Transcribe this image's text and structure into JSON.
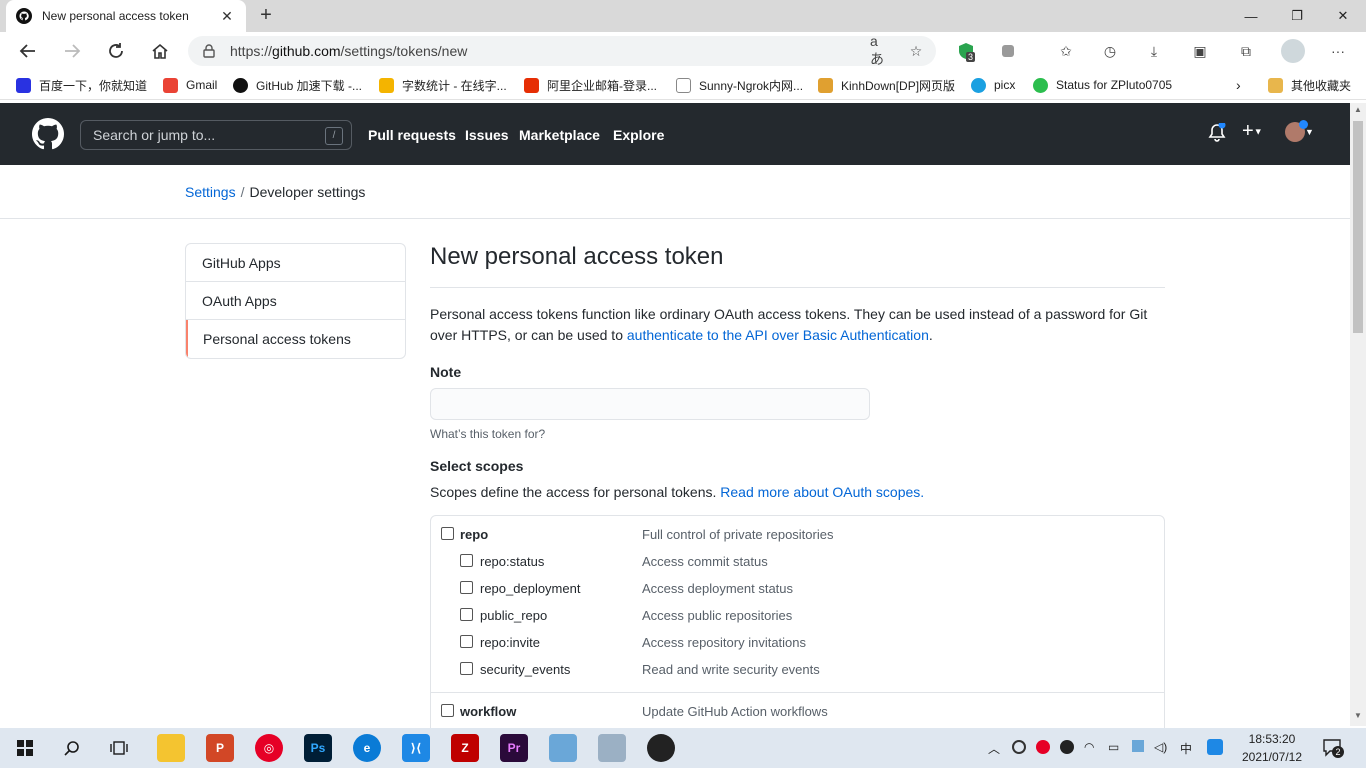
{
  "browser": {
    "tab_title": "New personal access token",
    "tab_close": "✕",
    "new_tab": "+",
    "url_prefix": "https://",
    "url_host": "github.com",
    "url_path": "/settings/tokens/new",
    "extension_badge": "3",
    "window_controls": {
      "minimize": "—",
      "restore": "❐",
      "close": "✕"
    }
  },
  "bookmarks": [
    {
      "label": "百度一下，你就知道",
      "color": "#2932e1"
    },
    {
      "label": "Gmail",
      "color": "#ea4335"
    },
    {
      "label": "GitHub 加速下载 -...",
      "color": "#111111"
    },
    {
      "label": "字数统计 - 在线字...",
      "color": "#f4b400"
    },
    {
      "label": "阿里企业邮箱-登录...",
      "color": "#e62e04"
    },
    {
      "label": "Sunny-Ngrok内网...",
      "color": "#888888"
    },
    {
      "label": "KinhDown[DP]网页版",
      "color": "#e0a030"
    },
    {
      "label": "picx",
      "color": "#1ba0e1"
    },
    {
      "label": "Status for ZPluto0705",
      "color": "#2cbe4e"
    },
    {
      "label": "其他收藏夹",
      "color": "#e8b64c"
    }
  ],
  "github": {
    "search_placeholder": "Search or jump to...",
    "search_shortcut": "/",
    "nav": [
      "Pull requests",
      "Issues",
      "Marketplace",
      "Explore"
    ]
  },
  "breadcrumb": {
    "parent": "Settings",
    "separator": "/",
    "current": "Developer settings"
  },
  "menu": [
    "GitHub Apps",
    "OAuth Apps",
    "Personal access tokens"
  ],
  "main": {
    "title": "New personal access token",
    "intro_text": "Personal access tokens function like ordinary OAuth access tokens. They can be used instead of a password for Git over HTTPS, or can be used to ",
    "intro_link": "authenticate to the API over Basic Authentication",
    "intro_end": ".",
    "note_label": "Note",
    "note_value": "",
    "note_hint": "What’s this token for?",
    "scopes_label": "Select scopes",
    "scopes_text": "Scopes define the access for personal tokens. ",
    "scopes_link": "Read more about OAuth scopes."
  },
  "scopes": {
    "repo": {
      "name": "repo",
      "desc": "Full control of private repositories"
    },
    "repo_children": [
      {
        "name": "repo:status",
        "desc": "Access commit status"
      },
      {
        "name": "repo_deployment",
        "desc": "Access deployment status"
      },
      {
        "name": "public_repo",
        "desc": "Access public repositories"
      },
      {
        "name": "repo:invite",
        "desc": "Access repository invitations"
      },
      {
        "name": "security_events",
        "desc": "Read and write security events"
      }
    ],
    "workflow": {
      "name": "workflow",
      "desc": "Update GitHub Action workflows"
    }
  },
  "taskbar": {
    "time": "18:53:20",
    "date": "2021/07/12",
    "ime": "中",
    "notification_count": "2"
  }
}
